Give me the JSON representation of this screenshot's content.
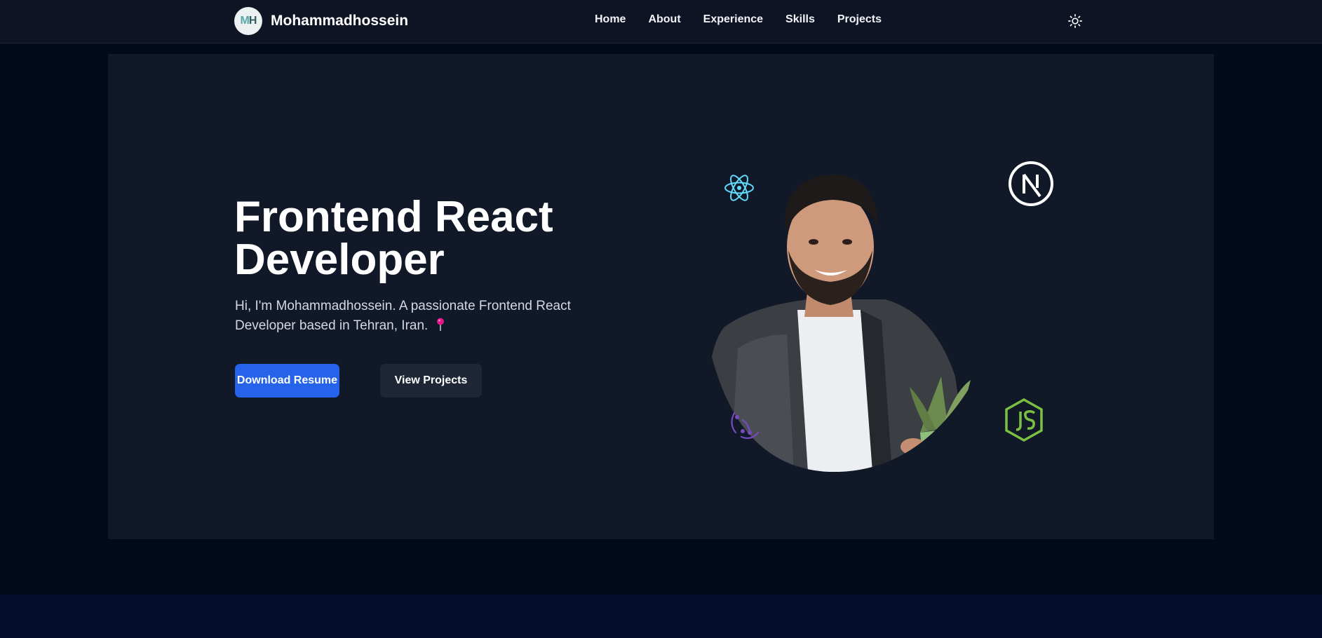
{
  "brand": {
    "logo_text_m": "M",
    "logo_text_h": "H",
    "name": "Mohammadhossein"
  },
  "nav": {
    "items": [
      {
        "label": "Home"
      },
      {
        "label": "About"
      },
      {
        "label": "Experience"
      },
      {
        "label": "Skills"
      },
      {
        "label": "Projects"
      }
    ],
    "theme_toggle_icon": "sun-icon"
  },
  "hero": {
    "title_line1": "Frontend React",
    "title_line2": "Developer",
    "description": "Hi, I'm Mohammadhossein. A passionate Frontend React Developer based in Tehran, Iran.",
    "description_icon": "pin-icon",
    "primary_button": "Download Resume",
    "secondary_button": "View Projects",
    "tech_icons": [
      "react-icon",
      "nextjs-icon",
      "redux-icon",
      "nodejs-icon"
    ]
  },
  "colors": {
    "page_bg": "#030a1c",
    "nav_bg": "#0e1423",
    "hero_bg": "#111828",
    "primary": "#2563eb",
    "secondary": "#1f2737",
    "react": "#61dafb",
    "redux": "#764abc",
    "node": "#7ac142"
  }
}
